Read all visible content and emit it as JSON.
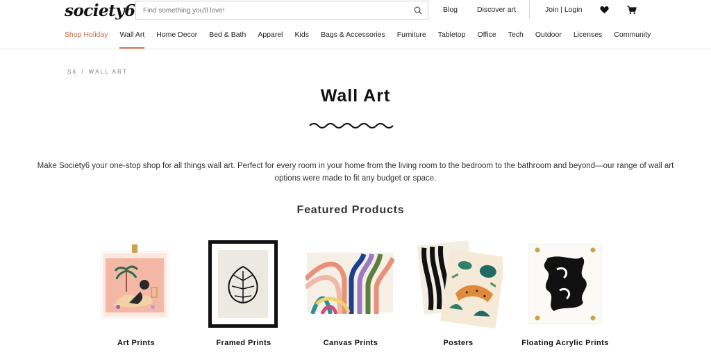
{
  "header": {
    "logo": "society6",
    "search_placeholder": "Find something you'll love!",
    "links": {
      "blog": "Blog",
      "discover": "Discover art",
      "join_login": "Join | Login"
    }
  },
  "nav": {
    "items": [
      "Shop Holiday",
      "Wall Art",
      "Home Decor",
      "Bed & Bath",
      "Apparel",
      "Kids",
      "Bags & Accessories",
      "Furniture",
      "Tabletop",
      "Office",
      "Tech",
      "Outdoor",
      "Licenses",
      "Community"
    ],
    "active": "Wall Art",
    "highlight": "Shop Holiday"
  },
  "breadcrumb": {
    "root": "S6",
    "sep": "/",
    "current": "WALL ART"
  },
  "page": {
    "title": "Wall Art",
    "intro_line1": "Make Society6 your one-stop shop for all things wall art. Perfect for every room in your home from the living room to the bedroom to the bathroom and beyond—our range of wall art",
    "intro_line2": "options were made to fit any budget or space.",
    "featured_title": "Featured Products"
  },
  "products": [
    {
      "label": "Art Prints",
      "icon": "art-print-image"
    },
    {
      "label": "Framed Prints",
      "icon": "framed-print-image"
    },
    {
      "label": "Canvas Prints",
      "icon": "canvas-print-image"
    },
    {
      "label": "Posters",
      "icon": "poster-image"
    },
    {
      "label": "Floating Acrylic Prints",
      "icon": "acrylic-print-image"
    }
  ],
  "colors": {
    "accent": "#e07150",
    "holiday": "#c96a45"
  }
}
